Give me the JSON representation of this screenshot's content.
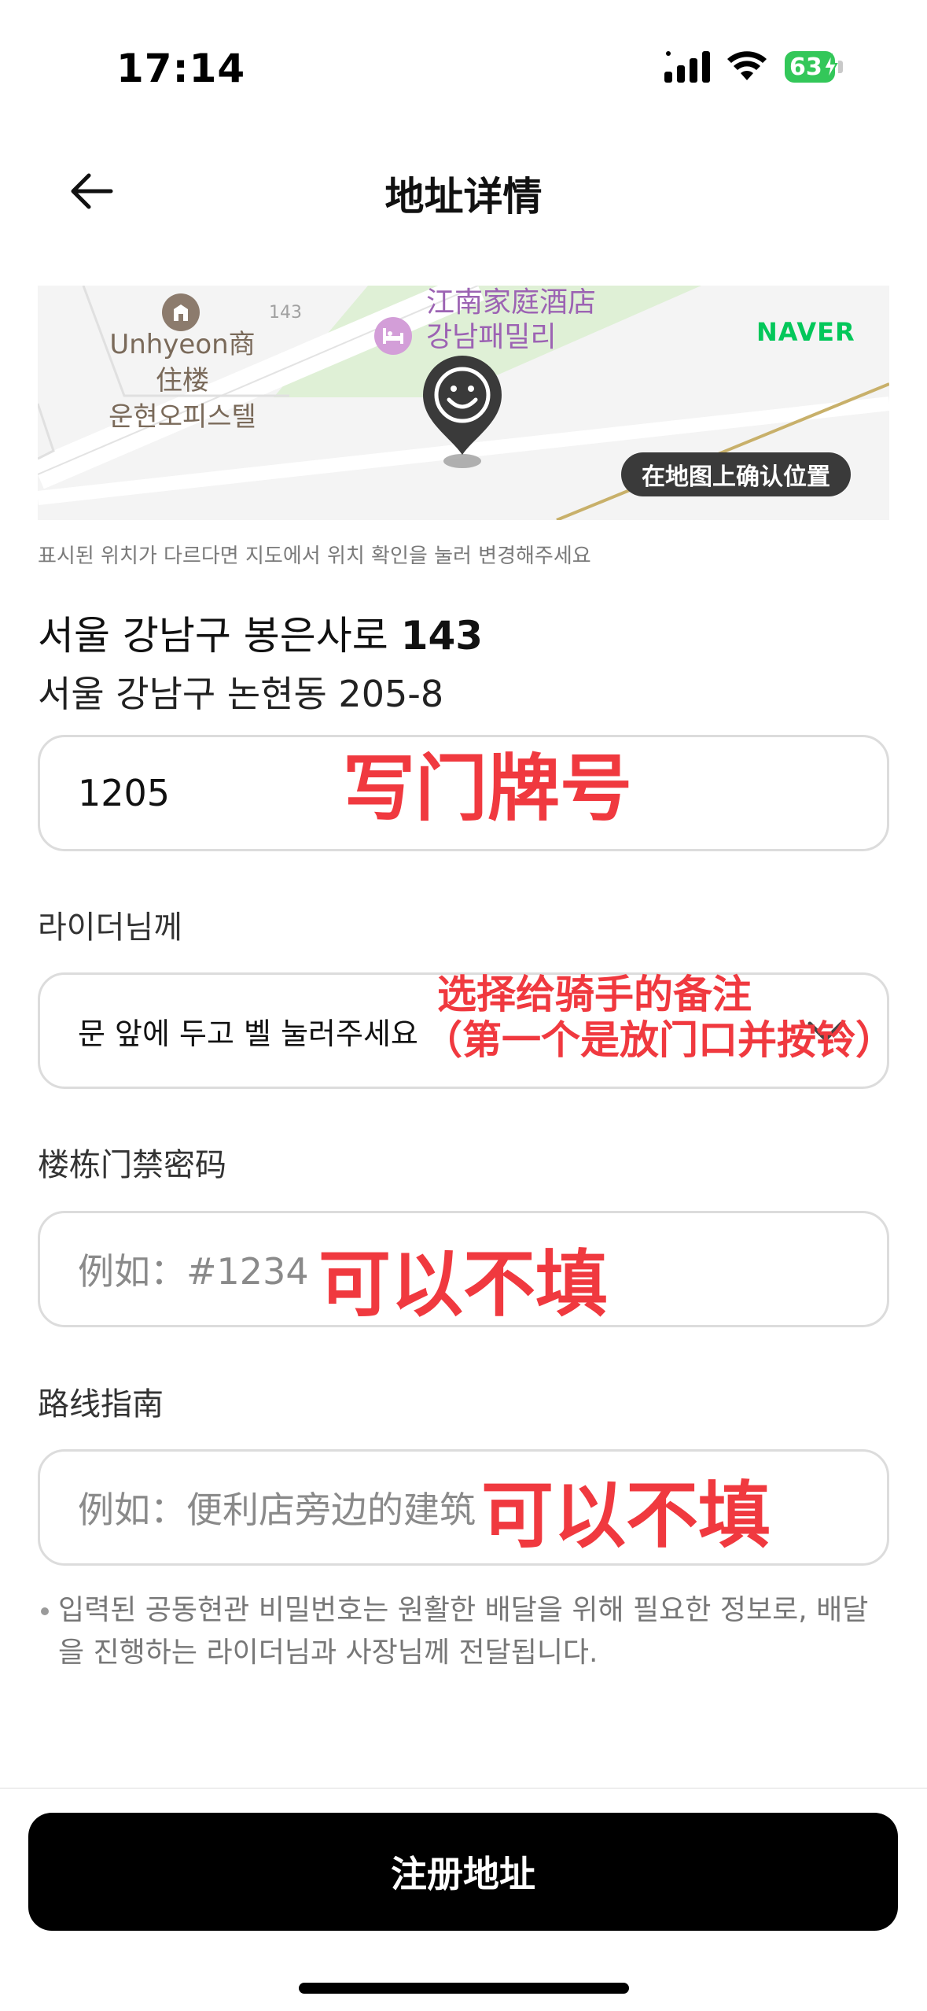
{
  "status_bar": {
    "time": "17:14",
    "battery": "63"
  },
  "header": {
    "title": "地址详情"
  },
  "map": {
    "building_label": "Unhyeon商住楼\n운현오피스텔",
    "building_line1": "Unhyeon商",
    "building_line2": "住楼",
    "building_line3": "운현오피스텔",
    "lot_number": "143",
    "hotel_line1": "江南家庭酒店",
    "hotel_line2": "강남패밀리",
    "provider": "NAVER",
    "confirm_button": "在地图上确认位置"
  },
  "map_hint": "표시된 위치가 다르다면 지도에서 위치 확인을 눌러 변경해주세요",
  "address": {
    "road_prefix": "서울 강남구 봉은사로 ",
    "road_number": "143",
    "jibun": "서울 강남구 논현동 205-8"
  },
  "form": {
    "unit_value": "1205",
    "rider_label": "라이더님께",
    "rider_value": "문 앞에 두고 벨 눌러주세요",
    "door_label": "楼栋门禁密码",
    "door_placeholder": "例如：#1234",
    "guide_label": "路线指南",
    "guide_placeholder": "例如：便利店旁边的建筑"
  },
  "annotations": {
    "unit": "写门牌号",
    "rider_line1": "选择给骑手的备注",
    "rider_line2": "（第一个是放门口并按铃）",
    "door": "可以不填",
    "guide": "可以不填"
  },
  "note": "입력된 공동현관 비밀번호는 원활한 배달을 위해 필요한 정보로, 배달을 진행하는 라이더님과 사장님께 전달됩니다.",
  "submit_button": "注册地址",
  "colors": {
    "naver_green": "#03c75a",
    "annotation_red": "#f0393f",
    "battery_green": "#33c759",
    "hotel_purple": "#9c63b3"
  }
}
